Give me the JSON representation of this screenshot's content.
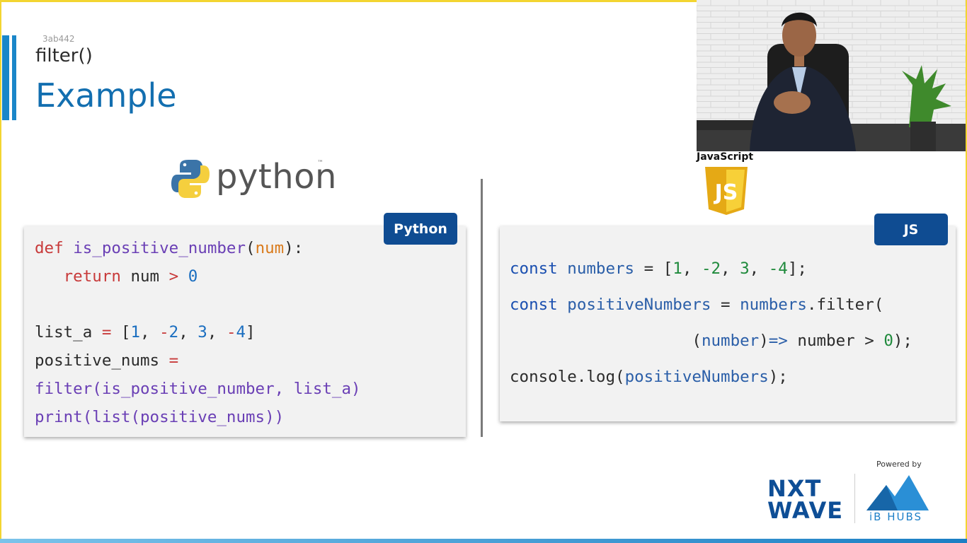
{
  "slide": {
    "id": "3ab442",
    "subtitle": "filter()",
    "title": "Example"
  },
  "python": {
    "logo_word": "python",
    "logo_tm": "™",
    "badge": "Python",
    "code_lines": [
      "def is_positive_number(num):",
      "   return num > 0",
      "",
      "list_a = [1, -2, 3, -4]",
      "positive_nums =",
      "filter(is_positive_number, list_a)",
      "print(list(positive_nums))"
    ]
  },
  "javascript": {
    "logo_label": "JavaScript",
    "logo_letters": "JS",
    "badge": "JS",
    "code_lines": [
      "const numbers = [1, -2, 3, -4];",
      "const positiveNumbers = numbers.filter(",
      "                   (number)=> number > 0);",
      "console.log(positiveNumbers);"
    ]
  },
  "footer": {
    "powered_by": "Powered by",
    "brand_line1": "NXT",
    "brand_line2": "WAVE",
    "partner": "iB HUBS"
  },
  "colors": {
    "title_blue": "#136fb0",
    "badge_blue": "#0f4c92",
    "frame_yellow": "#f3d531",
    "js_yellow": "#f0c419"
  }
}
